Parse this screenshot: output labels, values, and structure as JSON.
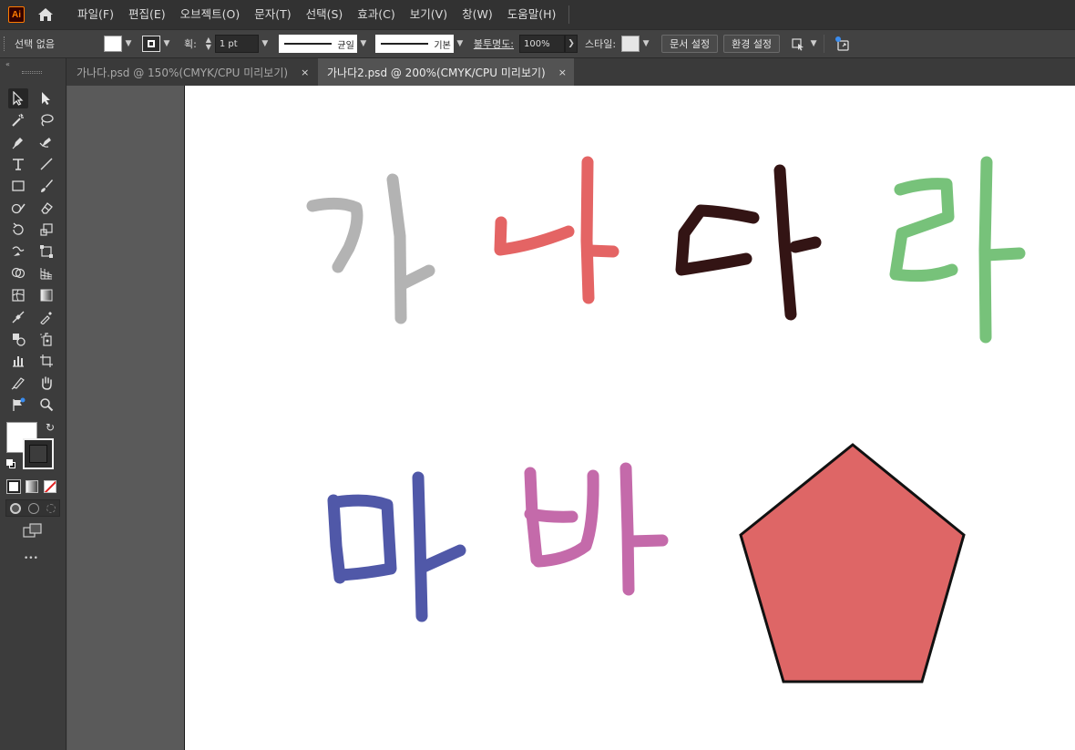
{
  "app": {
    "logo_text": "Ai"
  },
  "menu": [
    "파일(F)",
    "편집(E)",
    "오브젝트(O)",
    "문자(T)",
    "선택(S)",
    "효과(C)",
    "보기(V)",
    "창(W)",
    "도움말(H)"
  ],
  "control_bar": {
    "selection_label": "선택 없음",
    "stroke_label": "획:",
    "stroke_weight": "1 pt",
    "profile_label": "균일",
    "brush_label": "기본",
    "opacity_label": "불투명도:",
    "opacity_value": "100%",
    "style_label": "스타일:",
    "doc_setup_button": "문서 설정",
    "preferences_button": "환경 설정"
  },
  "tabs": [
    {
      "label": "가나다.psd @ 150%(CMYK/CPU 미리보기)",
      "close": "×",
      "active": false
    },
    {
      "label": "가나다2.psd @ 200%(CMYK/CPU 미리보기)",
      "close": "×",
      "active": true
    }
  ],
  "toolbox": {
    "more_label": "•••"
  },
  "artwork": {
    "glyphs": [
      {
        "char": "가",
        "color": "#b3b3b3"
      },
      {
        "char": "나",
        "color": "#e46464"
      },
      {
        "char": "다",
        "color": "#331414"
      },
      {
        "char": "라",
        "color": "#77c27a"
      },
      {
        "char": "마",
        "color": "#5058a8"
      },
      {
        "char": "바",
        "color": "#c46aaa"
      }
    ],
    "pentagon": {
      "fill": "#de6666",
      "stroke": "#111111"
    }
  }
}
